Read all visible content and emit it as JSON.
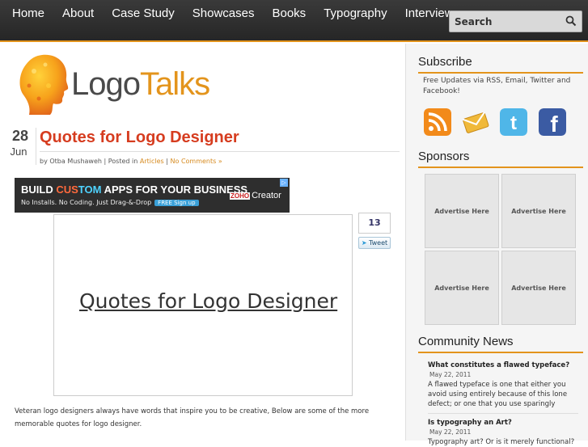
{
  "nav": {
    "items": [
      "Home",
      "About",
      "Case Study",
      "Showcases",
      "Books",
      "Typography",
      "Interviews"
    ],
    "search_placeholder": "Search"
  },
  "logo": {
    "part1": "Logo",
    "part2": "Talks"
  },
  "post": {
    "day": "28",
    "month": "Jun",
    "title": "Quotes for Logo Designer",
    "meta_prefix": "by Otba Mushaweh | Posted in",
    "category": "Articles",
    "sep": "|",
    "comments": "No Comments »",
    "image_caption": "Quotes for Logo Designer",
    "body": "Veteran logo designers always have words that inspire you to be creative, Below are some of the more memorable quotes for logo designer."
  },
  "ad": {
    "line1_a": "BUILD ",
    "line1_b": "CUS",
    "line1_c": "TOM",
    "line1_d": " APPS FOR YOUR BUSINESS",
    "line2": "No Installs. No Coding. Just Drag-&-Drop",
    "signup": "FREE Sign up",
    "brand_badge": "ZOHO",
    "brand": "Creator"
  },
  "share": {
    "count": "13",
    "tweet": "Tweet"
  },
  "sidebar": {
    "subscribe_title": "Subscribe",
    "subscribe_text": "Free Updates via RSS, Email, Twitter and Facebook!",
    "sponsors_title": "Sponsors",
    "ads": [
      "Advertise Here",
      "Advertise Here",
      "Advertise Here",
      "Advertise Here"
    ],
    "news_title": "Community News",
    "news": [
      {
        "title": "What constitutes a flawed typeface?",
        "date": "May 22, 2011",
        "body": "A flawed typeface is one that either you avoid using entirely because of this lone defect; or one that you use sparingly"
      },
      {
        "title": "Is typography an Art?",
        "date": "May 22, 2011",
        "body": "Typography art? Or is it merely functional?"
      }
    ]
  },
  "colors": {
    "accent": "#e3941c",
    "title_red": "#d63c1f",
    "nav_bg": "#2f2f2f"
  }
}
